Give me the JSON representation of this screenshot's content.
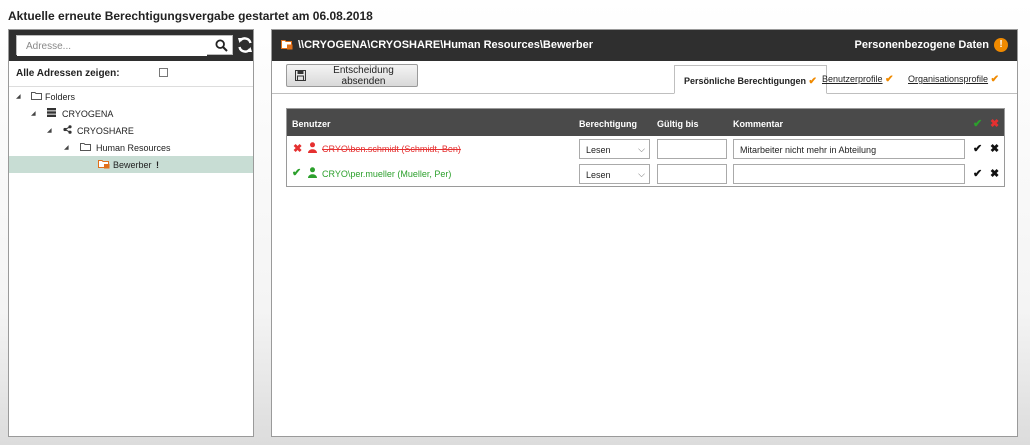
{
  "page": {
    "title": "Aktuelle erneute Berechtigungsvergabe gestartet am 06.08.2018"
  },
  "left": {
    "search": {
      "placeholder": "Adresse...",
      "value": ""
    },
    "show_all_label": "Alle Adressen zeigen:",
    "tree": [
      {
        "label": "Folders",
        "icon": "folder-icon",
        "level": 0
      },
      {
        "label": "CRYOGENA",
        "icon": "server-icon",
        "level": 1
      },
      {
        "label": "CRYOSHARE",
        "icon": "share-icon",
        "level": 2
      },
      {
        "label": "Human Resources",
        "icon": "folder-icon",
        "level": 3
      },
      {
        "label": "Bewerber",
        "icon": "sensitive-folder-icon",
        "level": 4,
        "selected": true,
        "flag": "!"
      }
    ]
  },
  "right": {
    "path": "\\\\CRYOGENA\\CRYOSHARE\\Human Resources\\Bewerber",
    "pd_label": "Personenbezogene Daten",
    "warn_symbol": "!",
    "submit_label": "Entscheidung absenden",
    "tabs": [
      {
        "label": "Persönliche Berechtigungen",
        "active": true
      },
      {
        "label": "Benutzerprofile",
        "active": false
      },
      {
        "label": "Organisationsprofile",
        "active": false
      }
    ],
    "table": {
      "headers": {
        "user": "Benutzer",
        "permission": "Berechtigung",
        "valid_until": "Gültig bis",
        "comment": "Kommentar"
      },
      "rows": [
        {
          "status": "denied",
          "user": "CRYO\\ben.schmidt (Schmidt, Ben)",
          "permission": "Lesen",
          "valid_until": "",
          "comment": "Mitarbeiter nicht mehr in Abteilung"
        },
        {
          "status": "granted",
          "user": "CRYO\\per.mueller (Mueller, Per)",
          "permission": "Lesen",
          "valid_until": "",
          "comment": ""
        }
      ]
    }
  },
  "colors": {
    "header_dark": "#2f2f2f",
    "accent_orange": "#f08a00",
    "denied_red": "#e53030",
    "granted_green": "#2ca02c",
    "selection": "#c8ddd4"
  }
}
